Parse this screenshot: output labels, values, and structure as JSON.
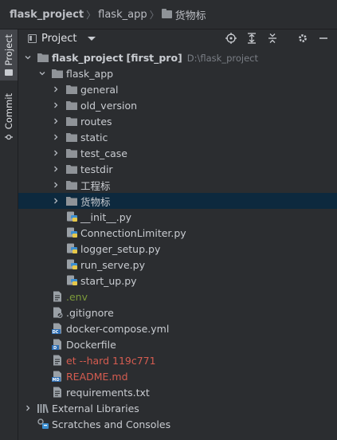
{
  "breadcrumb": {
    "project": "flask_project",
    "app": "flask_app",
    "current": "货物标"
  },
  "sidebar": {
    "project_tab": "Project",
    "commit_tab": "Commit"
  },
  "panel": {
    "title": "Project"
  },
  "tree": {
    "root": {
      "name": "flask_project",
      "module": "[first_pro]",
      "path": "D:\\flask_project"
    },
    "flask_app": "flask_app",
    "folders": [
      "general",
      "old_version",
      "routes",
      "static",
      "test_case",
      "testdir",
      "工程标",
      "货物标"
    ],
    "py_files": [
      "__init__.py",
      "ConnectionLimiter.py",
      "logger_setup.py",
      "run_serve.py",
      "start_up.py"
    ],
    "env_file": ".env",
    "gitignore": ".gitignore",
    "compose": "docker-compose.yml",
    "dockerfile": "Dockerfile",
    "git_file": "et --hard 119c771",
    "readme": "README.md",
    "requirements": "requirements.txt",
    "external": "External Libraries",
    "scratches": "Scratches and Consoles"
  },
  "colors": {
    "selected_row": "#0d293e",
    "green_text": "#7c9a3a",
    "red_text": "#d55c50",
    "folder": "#8f9398"
  }
}
